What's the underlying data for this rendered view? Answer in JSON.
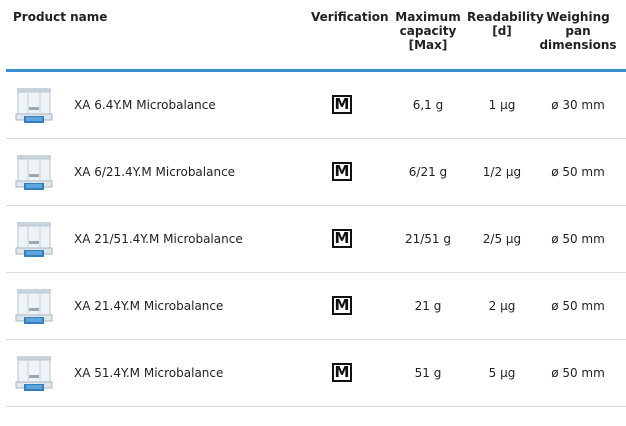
{
  "header": {
    "product_name": "Product name",
    "verification": "Verification",
    "max_capacity": [
      "Maximum",
      "capacity",
      "[Max]"
    ],
    "readability": [
      "Readability",
      "[d]"
    ],
    "weighing_pan": [
      "Weighing",
      "pan",
      "dimensions"
    ]
  },
  "accent_color": "#3b8ed0",
  "rows": [
    {
      "name": "XA 6.4Y.M Microbalance",
      "verification": "M",
      "capacity": "6,1 g",
      "readability": "1 µg",
      "dimensions": "ø 30 mm",
      "icon": "microbalance-icon"
    },
    {
      "name": "XA 6/21.4Y.M Microbalance",
      "verification": "M",
      "capacity": "6/21 g",
      "readability": "1/2 µg",
      "dimensions": "ø 50 mm",
      "icon": "microbalance-icon"
    },
    {
      "name": "XA 21/51.4Y.M Microbalance",
      "verification": "M",
      "capacity": "21/51 g",
      "readability": "2/5 µg",
      "dimensions": "ø 50 mm",
      "icon": "microbalance-icon"
    },
    {
      "name": "XA 21.4Y.M Microbalance",
      "verification": "M",
      "capacity": "21 g",
      "readability": "2 µg",
      "dimensions": "ø 50 mm",
      "icon": "microbalance-icon"
    },
    {
      "name": "XA 51.4Y.M Microbalance",
      "verification": "M",
      "capacity": "51 g",
      "readability": "5 µg",
      "dimensions": "ø 50 mm",
      "icon": "microbalance-icon"
    }
  ]
}
